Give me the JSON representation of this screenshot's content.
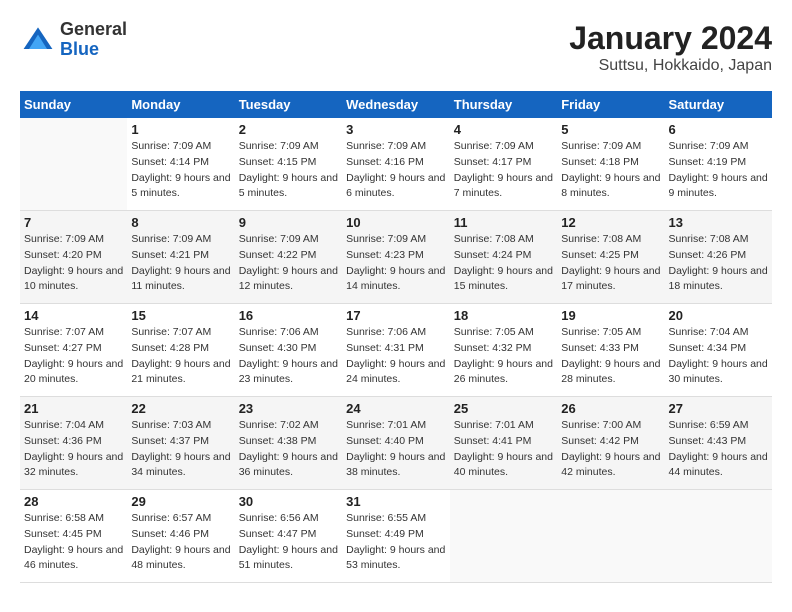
{
  "logo": {
    "line1": "General",
    "line2": "Blue"
  },
  "title": "January 2024",
  "subtitle": "Suttsu, Hokkaido, Japan",
  "days_of_week": [
    "Sunday",
    "Monday",
    "Tuesday",
    "Wednesday",
    "Thursday",
    "Friday",
    "Saturday"
  ],
  "weeks": [
    [
      {
        "num": "",
        "sunrise": "",
        "sunset": "",
        "daylight": ""
      },
      {
        "num": "1",
        "sunrise": "Sunrise: 7:09 AM",
        "sunset": "Sunset: 4:14 PM",
        "daylight": "Daylight: 9 hours and 5 minutes."
      },
      {
        "num": "2",
        "sunrise": "Sunrise: 7:09 AM",
        "sunset": "Sunset: 4:15 PM",
        "daylight": "Daylight: 9 hours and 5 minutes."
      },
      {
        "num": "3",
        "sunrise": "Sunrise: 7:09 AM",
        "sunset": "Sunset: 4:16 PM",
        "daylight": "Daylight: 9 hours and 6 minutes."
      },
      {
        "num": "4",
        "sunrise": "Sunrise: 7:09 AM",
        "sunset": "Sunset: 4:17 PM",
        "daylight": "Daylight: 9 hours and 7 minutes."
      },
      {
        "num": "5",
        "sunrise": "Sunrise: 7:09 AM",
        "sunset": "Sunset: 4:18 PM",
        "daylight": "Daylight: 9 hours and 8 minutes."
      },
      {
        "num": "6",
        "sunrise": "Sunrise: 7:09 AM",
        "sunset": "Sunset: 4:19 PM",
        "daylight": "Daylight: 9 hours and 9 minutes."
      }
    ],
    [
      {
        "num": "7",
        "sunrise": "Sunrise: 7:09 AM",
        "sunset": "Sunset: 4:20 PM",
        "daylight": "Daylight: 9 hours and 10 minutes."
      },
      {
        "num": "8",
        "sunrise": "Sunrise: 7:09 AM",
        "sunset": "Sunset: 4:21 PM",
        "daylight": "Daylight: 9 hours and 11 minutes."
      },
      {
        "num": "9",
        "sunrise": "Sunrise: 7:09 AM",
        "sunset": "Sunset: 4:22 PM",
        "daylight": "Daylight: 9 hours and 12 minutes."
      },
      {
        "num": "10",
        "sunrise": "Sunrise: 7:09 AM",
        "sunset": "Sunset: 4:23 PM",
        "daylight": "Daylight: 9 hours and 14 minutes."
      },
      {
        "num": "11",
        "sunrise": "Sunrise: 7:08 AM",
        "sunset": "Sunset: 4:24 PM",
        "daylight": "Daylight: 9 hours and 15 minutes."
      },
      {
        "num": "12",
        "sunrise": "Sunrise: 7:08 AM",
        "sunset": "Sunset: 4:25 PM",
        "daylight": "Daylight: 9 hours and 17 minutes."
      },
      {
        "num": "13",
        "sunrise": "Sunrise: 7:08 AM",
        "sunset": "Sunset: 4:26 PM",
        "daylight": "Daylight: 9 hours and 18 minutes."
      }
    ],
    [
      {
        "num": "14",
        "sunrise": "Sunrise: 7:07 AM",
        "sunset": "Sunset: 4:27 PM",
        "daylight": "Daylight: 9 hours and 20 minutes."
      },
      {
        "num": "15",
        "sunrise": "Sunrise: 7:07 AM",
        "sunset": "Sunset: 4:28 PM",
        "daylight": "Daylight: 9 hours and 21 minutes."
      },
      {
        "num": "16",
        "sunrise": "Sunrise: 7:06 AM",
        "sunset": "Sunset: 4:30 PM",
        "daylight": "Daylight: 9 hours and 23 minutes."
      },
      {
        "num": "17",
        "sunrise": "Sunrise: 7:06 AM",
        "sunset": "Sunset: 4:31 PM",
        "daylight": "Daylight: 9 hours and 24 minutes."
      },
      {
        "num": "18",
        "sunrise": "Sunrise: 7:05 AM",
        "sunset": "Sunset: 4:32 PM",
        "daylight": "Daylight: 9 hours and 26 minutes."
      },
      {
        "num": "19",
        "sunrise": "Sunrise: 7:05 AM",
        "sunset": "Sunset: 4:33 PM",
        "daylight": "Daylight: 9 hours and 28 minutes."
      },
      {
        "num": "20",
        "sunrise": "Sunrise: 7:04 AM",
        "sunset": "Sunset: 4:34 PM",
        "daylight": "Daylight: 9 hours and 30 minutes."
      }
    ],
    [
      {
        "num": "21",
        "sunrise": "Sunrise: 7:04 AM",
        "sunset": "Sunset: 4:36 PM",
        "daylight": "Daylight: 9 hours and 32 minutes."
      },
      {
        "num": "22",
        "sunrise": "Sunrise: 7:03 AM",
        "sunset": "Sunset: 4:37 PM",
        "daylight": "Daylight: 9 hours and 34 minutes."
      },
      {
        "num": "23",
        "sunrise": "Sunrise: 7:02 AM",
        "sunset": "Sunset: 4:38 PM",
        "daylight": "Daylight: 9 hours and 36 minutes."
      },
      {
        "num": "24",
        "sunrise": "Sunrise: 7:01 AM",
        "sunset": "Sunset: 4:40 PM",
        "daylight": "Daylight: 9 hours and 38 minutes."
      },
      {
        "num": "25",
        "sunrise": "Sunrise: 7:01 AM",
        "sunset": "Sunset: 4:41 PM",
        "daylight": "Daylight: 9 hours and 40 minutes."
      },
      {
        "num": "26",
        "sunrise": "Sunrise: 7:00 AM",
        "sunset": "Sunset: 4:42 PM",
        "daylight": "Daylight: 9 hours and 42 minutes."
      },
      {
        "num": "27",
        "sunrise": "Sunrise: 6:59 AM",
        "sunset": "Sunset: 4:43 PM",
        "daylight": "Daylight: 9 hours and 44 minutes."
      }
    ],
    [
      {
        "num": "28",
        "sunrise": "Sunrise: 6:58 AM",
        "sunset": "Sunset: 4:45 PM",
        "daylight": "Daylight: 9 hours and 46 minutes."
      },
      {
        "num": "29",
        "sunrise": "Sunrise: 6:57 AM",
        "sunset": "Sunset: 4:46 PM",
        "daylight": "Daylight: 9 hours and 48 minutes."
      },
      {
        "num": "30",
        "sunrise": "Sunrise: 6:56 AM",
        "sunset": "Sunset: 4:47 PM",
        "daylight": "Daylight: 9 hours and 51 minutes."
      },
      {
        "num": "31",
        "sunrise": "Sunrise: 6:55 AM",
        "sunset": "Sunset: 4:49 PM",
        "daylight": "Daylight: 9 hours and 53 minutes."
      },
      {
        "num": "",
        "sunrise": "",
        "sunset": "",
        "daylight": ""
      },
      {
        "num": "",
        "sunrise": "",
        "sunset": "",
        "daylight": ""
      },
      {
        "num": "",
        "sunrise": "",
        "sunset": "",
        "daylight": ""
      }
    ]
  ]
}
